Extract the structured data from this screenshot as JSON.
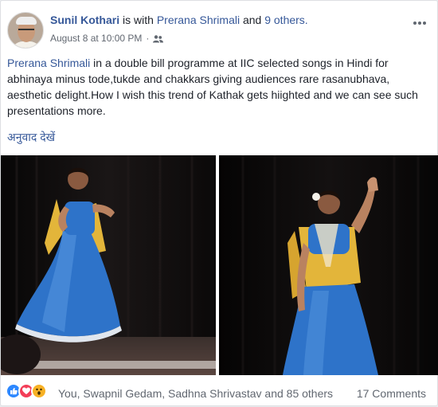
{
  "post": {
    "author": "Sunil Kothari",
    "with_text": "is with",
    "tagged_person": "Prerana Shrimali",
    "and_text": "and",
    "others_link": "9 others.",
    "timestamp": "August 8 at 10:00 PM",
    "separator": "·",
    "audience_icon": "friends-icon",
    "more_icon": "more-options-icon",
    "text_mention": "Prerana Shrimali",
    "text_body": " in a double bill programme at IIC selected songs in Hindi for abhinaya minus tode,tukde and chakkars giving audiences rare rasanubhava, aesthetic delight.How I wish this trend of Kathak gets hiighted and we can see such presentations more.",
    "see_translation": "अनुवाद देखें"
  },
  "footer": {
    "reactions_summary": "You, Swapnil Gedam, Sadhna Shrivastav and 85 others",
    "comments_count": "17 Comments",
    "reaction_icons": [
      "like-icon",
      "love-icon",
      "wow-icon"
    ]
  },
  "colors": {
    "link": "#365899",
    "secondary_text": "#616770",
    "like": "#2d88ff",
    "love": "#f33e58",
    "wow": "#f7b125",
    "dancer_skirt": "#2e73c9",
    "dancer_dupatta": "#e3b53a"
  }
}
